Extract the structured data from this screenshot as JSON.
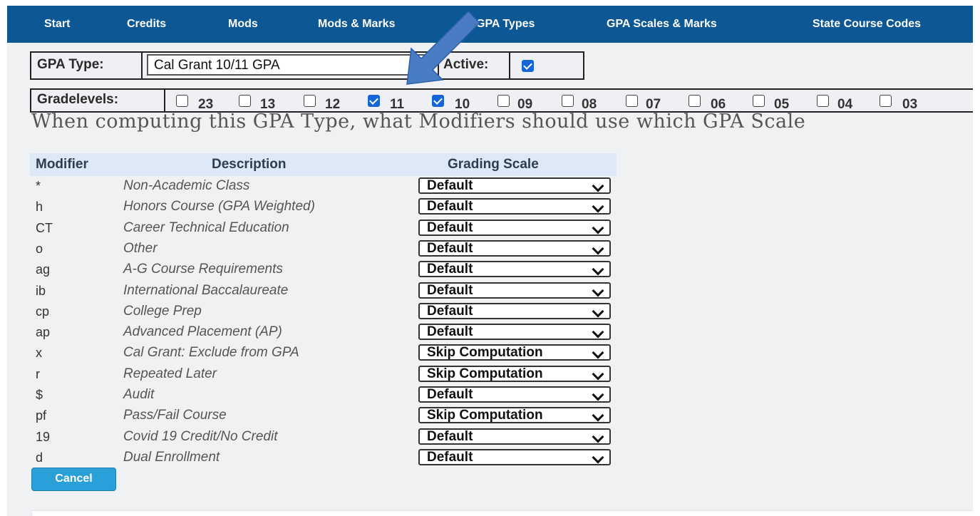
{
  "nav": {
    "items": [
      "Start",
      "Credits",
      "Mods",
      "Mods & Marks",
      "GPA Types",
      "GPA Scales & Marks",
      "State Course Codes"
    ]
  },
  "gpa_type": {
    "label": "GPA Type:",
    "value": "Cal Grant 10/11 GPA",
    "active_label": "Active:",
    "active_checked": true
  },
  "gradelevels": {
    "label": "Gradelevels:",
    "levels": [
      {
        "label": "23",
        "checked": false
      },
      {
        "label": "13",
        "checked": false
      },
      {
        "label": "12",
        "checked": false
      },
      {
        "label": "11",
        "checked": true
      },
      {
        "label": "10",
        "checked": true
      },
      {
        "label": "09",
        "checked": false
      },
      {
        "label": "08",
        "checked": false
      },
      {
        "label": "07",
        "checked": false
      },
      {
        "label": "06",
        "checked": false
      },
      {
        "label": "05",
        "checked": false
      },
      {
        "label": "04",
        "checked": false
      },
      {
        "label": "03",
        "checked": false
      }
    ]
  },
  "question": "When computing this GPA Type, what Modifiers should use which GPA Scale",
  "table": {
    "headers": {
      "modifier": "Modifier",
      "description": "Description",
      "scale": "Grading Scale"
    },
    "rows": [
      {
        "modifier": "*",
        "description": "Non-Academic Class",
        "scale": "Default"
      },
      {
        "modifier": "h",
        "description": "Honors Course (GPA Weighted)",
        "scale": "Default"
      },
      {
        "modifier": "CT",
        "description": "Career Technical Education",
        "scale": "Default"
      },
      {
        "modifier": "o",
        "description": "Other",
        "scale": "Default"
      },
      {
        "modifier": "ag",
        "description": "A-G Course Requirements",
        "scale": "Default"
      },
      {
        "modifier": "ib",
        "description": "International Baccalaureate",
        "scale": "Default"
      },
      {
        "modifier": "cp",
        "description": "College Prep",
        "scale": "Default"
      },
      {
        "modifier": "ap",
        "description": "Advanced Placement (AP)",
        "scale": "Default"
      },
      {
        "modifier": "x",
        "description": "Cal Grant: Exclude from GPA",
        "scale": "Skip Computation"
      },
      {
        "modifier": "r",
        "description": "Repeated Later",
        "scale": "Skip Computation"
      },
      {
        "modifier": "$",
        "description": "Audit",
        "scale": "Default"
      },
      {
        "modifier": "pf",
        "description": "Pass/Fail Course",
        "scale": "Skip Computation"
      },
      {
        "modifier": "19",
        "description": "Covid 19 Credit/No Credit",
        "scale": "Default"
      },
      {
        "modifier": "d",
        "description": "Dual Enrollment",
        "scale": "Default"
      }
    ]
  },
  "cancel_label": "Cancel",
  "arrow_color": "#4a7cc4"
}
